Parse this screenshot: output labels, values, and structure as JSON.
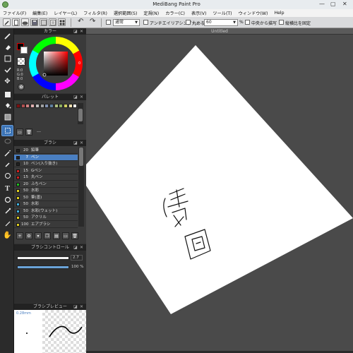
{
  "app": {
    "title": "MediBang Paint Pro",
    "window_controls": [
      "—",
      "▢",
      "✕"
    ]
  },
  "menu": [
    "ファイル(F)",
    "編集(E)",
    "レイヤー(L)",
    "フィルタ(R)",
    "選択範囲(S)",
    "定規(N)",
    "カラー(C)",
    "表示(V)",
    "ツール(T)",
    "ウィンドウ(W)",
    "Help"
  ],
  "toolbar": {
    "blend_mode": "通常",
    "antialias_label": "アンチエイリアシング",
    "round_label": "丸める",
    "round_value": "60",
    "percent": "%",
    "center_label": "中央から描写",
    "aspect_label": "縦横比を固定"
  },
  "toolbox": {
    "tools": [
      "brush-icon",
      "eraser-icon",
      "rect-select-icon",
      "check-icon",
      "move-icon",
      "fill-rect-icon",
      "bucket-icon",
      "gradient-icon",
      "select-pen-icon",
      "lasso-icon",
      "magic-wand-icon",
      "dropper-icon",
      "text-icon",
      "shape-icon",
      "eyedropper-icon",
      "hand-icon"
    ]
  },
  "color_panel": {
    "title": "カラー",
    "rgb": [
      "R:0",
      "G:0",
      "B:0"
    ],
    "fg_color": "#000000",
    "bg_color": "#ffffff",
    "hue_marker": "0"
  },
  "palette_panel": {
    "title": "パレット",
    "colors": [
      "#7a1010",
      "#b05050",
      "#d08080",
      "#e0b0b0",
      "#c0c0c0",
      "#a0a0a0",
      "#8090b0",
      "#6080a0",
      "#b0c080",
      "#90b060",
      "#d0d060",
      "#f0e0b0",
      "#ffffff"
    ],
    "footer": "---"
  },
  "brush_panel": {
    "title": "ブラシ",
    "items": [
      {
        "color": "#222222",
        "size": "20",
        "name": "鉛筆"
      },
      {
        "color": "#222222",
        "size": "7",
        "name": "ペン"
      },
      {
        "color": "#222222",
        "size": "10",
        "name": "ペン(入り抜き)"
      },
      {
        "color": "#d02020",
        "size": "15",
        "name": "Gペン"
      },
      {
        "color": "#d02020",
        "size": "15",
        "name": "丸ペン"
      },
      {
        "color": "#20c020",
        "size": "20",
        "name": "ふちペン"
      },
      {
        "color": "#e0d020",
        "size": "50",
        "name": "水彩"
      },
      {
        "color": "#e0d020",
        "size": "50",
        "name": "筆(墨)"
      },
      {
        "color": "#40b0e0",
        "size": "50",
        "name": "水彩"
      },
      {
        "color": "#40b0e0",
        "size": "50",
        "name": "水彩(ウェット)"
      },
      {
        "color": "#e0d020",
        "size": "50",
        "name": "アクリル"
      },
      {
        "color": "#e0d020",
        "size": "100",
        "name": "エアブラシ"
      }
    ],
    "selected_index": 1
  },
  "brush_control": {
    "title": "ブラシコントロール",
    "size_value": "2.7",
    "size_fraction": 0.95,
    "opacity_value": "100 %",
    "opacity_fraction": 1.0
  },
  "brush_preview": {
    "title": "ブラシプレビュー",
    "size_label": "0.28mm"
  },
  "canvas": {
    "doc_title": "Untitled",
    "paper_color": "#ffffff",
    "background_color": "#4a4a4a",
    "drawing_text": "津田"
  }
}
